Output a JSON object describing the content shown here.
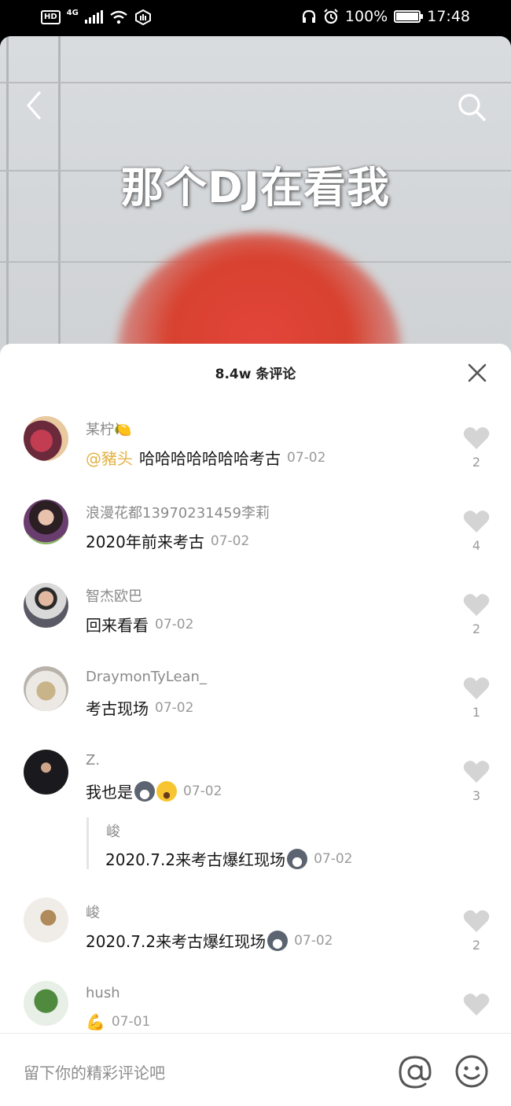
{
  "status_bar": {
    "hd": "HD",
    "network": "4G",
    "battery_percent": "100%",
    "time": "17:48"
  },
  "video": {
    "caption": "那个DJ在看我"
  },
  "comments_sheet": {
    "title": "8.4w 条评论",
    "comments": [
      {
        "username": "某柠🍋",
        "mention": "@豬头",
        "text": "哈哈哈哈哈哈哈考古",
        "date": "07-02",
        "likes": "2"
      },
      {
        "username": "浪漫花都13970231459李莉",
        "text": "2020年前来考古",
        "date": "07-02",
        "likes": "4"
      },
      {
        "username": "智杰欧巴",
        "text": "回来看看",
        "date": "07-02",
        "likes": "2"
      },
      {
        "username": "DraymonTyLean_",
        "text": "考古现场",
        "date": "07-02",
        "likes": "1"
      },
      {
        "username": "Z.",
        "text": "我也是",
        "date": "07-02",
        "likes": "3",
        "reply": {
          "username": "峻",
          "text": "2020.7.2来考古爆红现场",
          "date": "07-02"
        }
      },
      {
        "username": "峻",
        "text": "2020.7.2来考古爆红现场",
        "date": "07-02",
        "likes": "2"
      },
      {
        "username": "hush",
        "text": "💪",
        "date": "07-01",
        "likes": ""
      }
    ]
  },
  "input_bar": {
    "placeholder": "留下你的精彩评论吧"
  },
  "colors": {
    "mention": "#e4b143",
    "username": "#8a8a8a",
    "heart": "#d4d4d4"
  }
}
